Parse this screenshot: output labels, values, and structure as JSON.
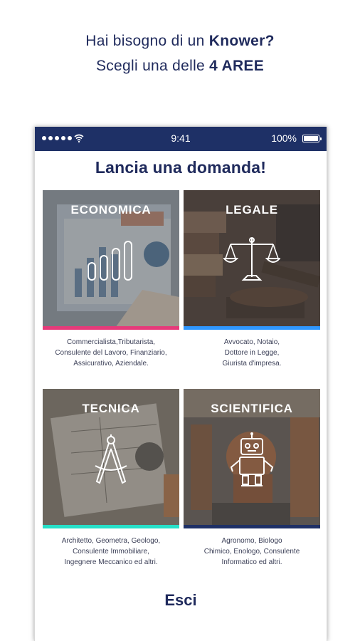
{
  "promo": {
    "line1_prefix": "Hai bisogno di un ",
    "line1_bold": "Knower?",
    "line2_prefix": "Scegli una delle ",
    "line2_bold": "4 AREE"
  },
  "statusbar": {
    "time": "9:41",
    "battery": "100%"
  },
  "headline": "Lancia una domanda!",
  "areas": [
    {
      "title": "ECONOMICA",
      "icon": "bar-chart-icon",
      "accent": "#e63a7a",
      "desc_lines": [
        "Commercialista,Tributarista,",
        "Consulente del Lavoro, Finanziario,",
        "Assicurativo, Aziendale."
      ]
    },
    {
      "title": "LEGALE",
      "icon": "scales-icon",
      "accent": "#2f97ff",
      "desc_lines": [
        "Avvocato, Notaio,",
        "Dottore in Legge,",
        "Giurista d'impresa."
      ]
    },
    {
      "title": "TECNICA",
      "icon": "compass-icon",
      "accent": "#26e0c8",
      "desc_lines": [
        "Architetto, Geometra, Geologo,",
        "Consulente Immobiliare,",
        "Ingegnere Meccanico ed altri."
      ]
    },
    {
      "title": "SCIENTIFICA",
      "icon": "robot-icon",
      "accent": "#1e3066",
      "desc_lines": [
        "Agronomo, Biologo",
        "Chimico, Enologo, Consulente",
        "Informatico ed altri."
      ]
    }
  ],
  "exit_label": "Esci",
  "colors": {
    "brand_navy": "#1f2a5c",
    "statusbar": "#1e3066"
  }
}
